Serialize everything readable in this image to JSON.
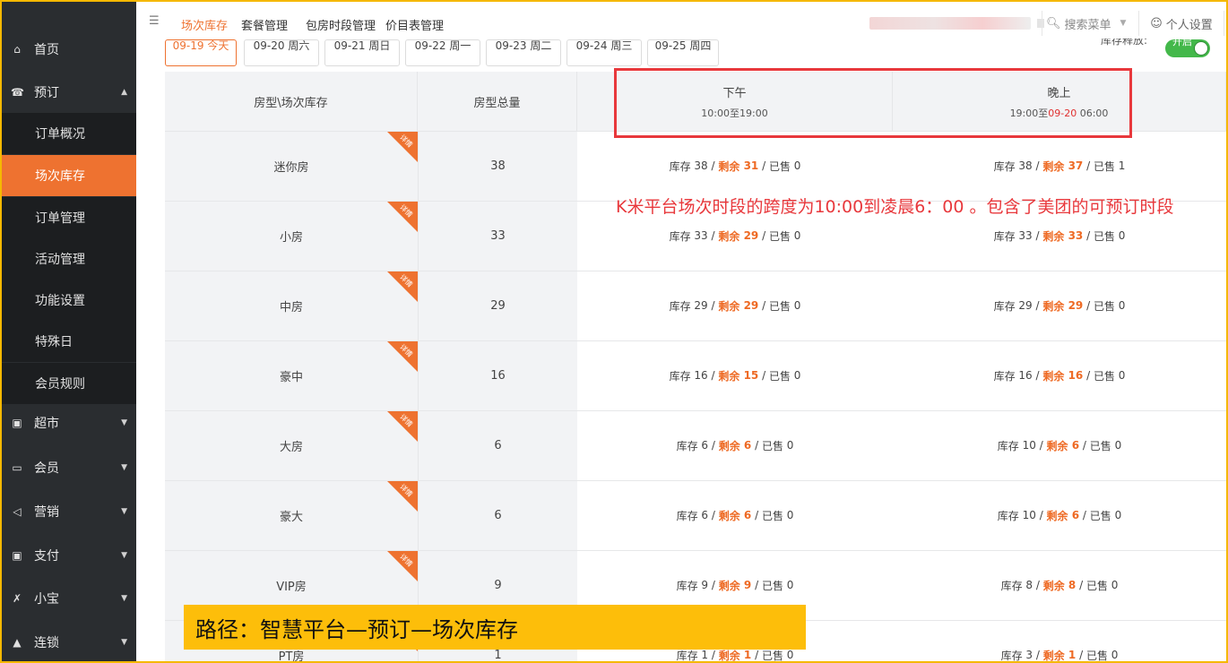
{
  "sidebar": {
    "items": [
      {
        "label": "首页",
        "icon": "home-icon",
        "glyph": "⌂"
      },
      {
        "label": "预订",
        "icon": "booking-icon",
        "glyph": "☎",
        "expanded": true
      },
      {
        "label": "超市",
        "icon": "supermarket-icon",
        "glyph": "▣"
      },
      {
        "label": "会员",
        "icon": "member-card-icon",
        "glyph": "▭"
      },
      {
        "label": "营销",
        "icon": "megaphone-icon",
        "glyph": "◁"
      },
      {
        "label": "支付",
        "icon": "payment-icon",
        "glyph": "▣"
      },
      {
        "label": "小宝",
        "icon": "assistant-icon",
        "glyph": "✗"
      },
      {
        "label": "连锁",
        "icon": "chain-store-icon",
        "glyph": "▲"
      }
    ],
    "booking_submenu": [
      "订单概况",
      "场次库存",
      "订单管理",
      "活动管理",
      "功能设置",
      "特殊日",
      "会员规则"
    ],
    "active_submenu": "场次库存"
  },
  "topbar": {
    "tabs": [
      "场次库存",
      "套餐管理",
      "包房时段管理",
      "价目表管理"
    ],
    "active_tab": "场次库存",
    "search_label": "搜索菜单",
    "personal_label": "个人设置"
  },
  "date_tabs": [
    "09-19 今天",
    "09-20 周六",
    "09-21 周日",
    "09-22 周一",
    "09-23 周二",
    "09-24 周三",
    "09-25 周四"
  ],
  "active_date": "09-19 今天",
  "inventory_mode": {
    "label": "库存释放:",
    "toggle_label": "开启",
    "on": true
  },
  "table": {
    "headers": {
      "room_type": "房型\\场次库存",
      "total": "房型总量",
      "afternoon": {
        "title": "下午",
        "time": "10:00至19:00"
      },
      "evening": {
        "title": "晚上",
        "time_start": "19:00至",
        "time_date": "09-20",
        "time_end": " 06:00"
      }
    },
    "corner_label": "详情",
    "rows": [
      {
        "name": "迷你房",
        "total": "38",
        "pm": {
          "stock": "38",
          "remain": "31",
          "sold": "0"
        },
        "eve": {
          "stock": "38",
          "remain": "37",
          "sold": "1"
        }
      },
      {
        "name": "小房",
        "total": "33",
        "pm": {
          "stock": "33",
          "remain": "29",
          "sold": "0"
        },
        "eve": {
          "stock": "33",
          "remain": "33",
          "sold": "0"
        }
      },
      {
        "name": "中房",
        "total": "29",
        "pm": {
          "stock": "29",
          "remain": "29",
          "sold": "0"
        },
        "eve": {
          "stock": "29",
          "remain": "29",
          "sold": "0"
        }
      },
      {
        "name": "豪中",
        "total": "16",
        "pm": {
          "stock": "16",
          "remain": "15",
          "sold": "0"
        },
        "eve": {
          "stock": "16",
          "remain": "16",
          "sold": "0"
        }
      },
      {
        "name": "大房",
        "total": "6",
        "pm": {
          "stock": "6",
          "remain": "6",
          "sold": "0"
        },
        "eve": {
          "stock": "10",
          "remain": "6",
          "sold": "0"
        }
      },
      {
        "name": "豪大",
        "total": "6",
        "pm": {
          "stock": "6",
          "remain": "6",
          "sold": "0"
        },
        "eve": {
          "stock": "10",
          "remain": "6",
          "sold": "0"
        }
      },
      {
        "name": "VIP房",
        "total": "9",
        "pm": {
          "stock": "9",
          "remain": "9",
          "sold": "0"
        },
        "eve": {
          "stock": "8",
          "remain": "8",
          "sold": "0"
        }
      },
      {
        "name": "PT房",
        "total": "1",
        "pm": {
          "stock": "1",
          "remain": "1",
          "sold": "0"
        },
        "eve": {
          "stock": "3",
          "remain": "1",
          "sold": "0"
        }
      }
    ],
    "labels": {
      "stock": "库存 ",
      "remain": "剩余 ",
      "sold": "已售 ",
      "sep": " / "
    }
  },
  "annotation": "K米平台场次时段的跨度为10:00到凌晨6：00 。包含了美团的可预订时段",
  "banner": "路径：智慧平台—预订—场次库存",
  "colors": {
    "accent": "#ee7230",
    "sidebar": "#2a2d30",
    "annotation": "#e8383c",
    "banner": "#fdbe0a"
  }
}
